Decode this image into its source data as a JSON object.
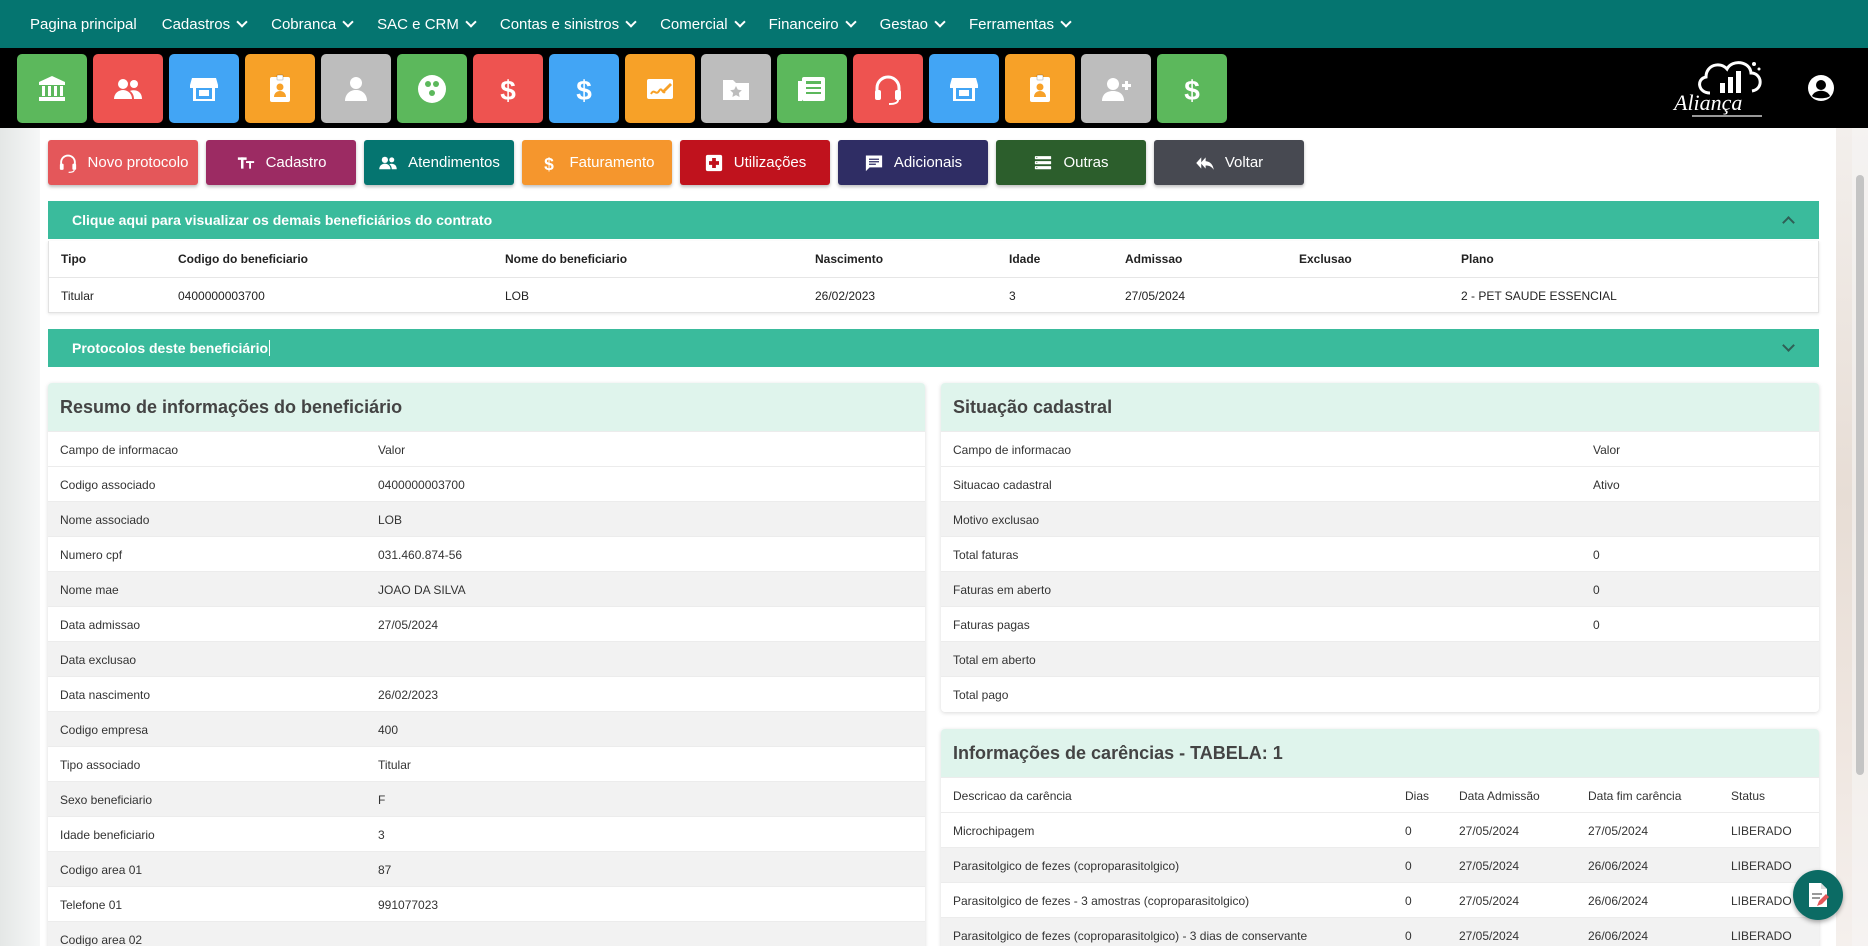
{
  "topnav": {
    "items": [
      {
        "label": "Pagina principal",
        "dropdown": false
      },
      {
        "label": "Cadastros",
        "dropdown": true
      },
      {
        "label": "Cobranca",
        "dropdown": true
      },
      {
        "label": "SAC e CRM",
        "dropdown": true
      },
      {
        "label": "Contas e sinistros",
        "dropdown": true
      },
      {
        "label": "Comercial",
        "dropdown": true
      },
      {
        "label": "Financeiro",
        "dropdown": true
      },
      {
        "label": "Gestao",
        "dropdown": true
      },
      {
        "label": "Ferramentas",
        "dropdown": true
      }
    ]
  },
  "iconbar": {
    "tiles": [
      {
        "icon": "bank-icon",
        "color": "#5cb85c"
      },
      {
        "icon": "users-icon",
        "color": "#ee5350"
      },
      {
        "icon": "store-icon",
        "color": "#42a5f5"
      },
      {
        "icon": "id-badge-icon",
        "color": "#f7a128"
      },
      {
        "icon": "person-icon",
        "color": "#bdbdbd"
      },
      {
        "icon": "group-circle-icon",
        "color": "#5cb85c"
      },
      {
        "icon": "dollar-icon",
        "color": "#ee5350"
      },
      {
        "icon": "dollar-icon",
        "color": "#42a5f5"
      },
      {
        "icon": "signature-icon",
        "color": "#f7a128"
      },
      {
        "icon": "folder-star-icon",
        "color": "#bdbdbd"
      },
      {
        "icon": "newspaper-icon",
        "color": "#5cb85c"
      },
      {
        "icon": "headset-icon",
        "color": "#ee5350"
      },
      {
        "icon": "store-icon",
        "color": "#42a5f5"
      },
      {
        "icon": "id-badge-icon",
        "color": "#f7a128"
      },
      {
        "icon": "add-user-icon",
        "color": "#bdbdbd"
      },
      {
        "icon": "dollar-icon",
        "color": "#5cb85c"
      }
    ],
    "logo_text": "Aliança"
  },
  "actions": [
    {
      "label": "Novo protocolo",
      "icon": "headset-icon",
      "color": "#e4575a"
    },
    {
      "label": "Cadastro",
      "icon": "text-size-icon",
      "color": "#9c2b63"
    },
    {
      "label": "Atendimentos",
      "icon": "users-icon",
      "color": "#057570"
    },
    {
      "label": "Faturamento",
      "icon": "dollar-icon",
      "color": "#f5962d"
    },
    {
      "label": "Utilizações",
      "icon": "medical-plus-icon",
      "color": "#c0121d"
    },
    {
      "label": "Adicionais",
      "icon": "comment-icon",
      "color": "#2f2d64"
    },
    {
      "label": "Outras",
      "icon": "list-icon",
      "color": "#2c5e2c"
    },
    {
      "label": "Voltar",
      "icon": "reply-all-icon",
      "color": "#474951"
    }
  ],
  "beneficiaries": {
    "header": "Clique aqui para visualizar os demais beneficiários do contrato",
    "columns": [
      "Tipo",
      "Codigo do beneficiario",
      "Nome do beneficiario",
      "Nascimento",
      "Idade",
      "Admissao",
      "Exclusao",
      "Plano"
    ],
    "row": [
      "Titular",
      "0400000003700",
      "LOB",
      "26/02/2023",
      "3",
      "27/05/2024",
      "",
      "2 - PET SAUDE ESSENCIAL"
    ]
  },
  "protocols": {
    "header": "Protocolos deste beneficiário"
  },
  "resumo": {
    "title": "Resumo de informações do beneficiário",
    "columns": [
      "Campo de informacao",
      "Valor"
    ],
    "rows": [
      [
        "Codigo associado",
        "0400000003700"
      ],
      [
        "Nome associado",
        "LOB"
      ],
      [
        "Numero cpf",
        "031.460.874-56"
      ],
      [
        "Nome mae",
        "JOAO DA SILVA"
      ],
      [
        "Data admissao",
        "27/05/2024"
      ],
      [
        "Data exclusao",
        ""
      ],
      [
        "Data nascimento",
        "26/02/2023"
      ],
      [
        "Codigo empresa",
        "400"
      ],
      [
        "Tipo associado",
        "Titular"
      ],
      [
        "Sexo beneficiario",
        "F"
      ],
      [
        "Idade beneficiario",
        "3"
      ],
      [
        "Codigo area 01",
        "87"
      ],
      [
        "Telefone 01",
        "991077023"
      ],
      [
        "Codigo area 02",
        ""
      ]
    ]
  },
  "situacao": {
    "title": "Situação cadastral",
    "columns": [
      "Campo de informacao",
      "Valor"
    ],
    "rows": [
      [
        "Situacao cadastral",
        "Ativo"
      ],
      [
        "Motivo exclusao",
        ""
      ],
      [
        "Total faturas",
        "0"
      ],
      [
        "Faturas em aberto",
        "0"
      ],
      [
        "Faturas pagas",
        "0"
      ],
      [
        "Total em aberto",
        ""
      ],
      [
        "Total pago",
        ""
      ]
    ]
  },
  "carencias": {
    "title": "Informações de carências - TABELA: 1",
    "columns": [
      "Descricao da carência",
      "Dias",
      "Data Admissão",
      "Data fim carência",
      "Status"
    ],
    "rows": [
      [
        "Microchipagem",
        "0",
        "27/05/2024",
        "27/05/2024",
        "LIBERADO"
      ],
      [
        "Parasitolgico de fezes (coproparasitolgico)",
        "0",
        "27/05/2024",
        "26/06/2024",
        "LIBERADO"
      ],
      [
        "Parasitolgico de fezes - 3 amostras (coproparasitolgico)",
        "0",
        "27/05/2024",
        "26/06/2024",
        "LIBERADO"
      ],
      [
        "Parasitolgico de fezes (coproparasitolgico) - 3 dias de conservante",
        "0",
        "27/05/2024",
        "26/06/2024",
        "LIBERADO"
      ]
    ]
  }
}
